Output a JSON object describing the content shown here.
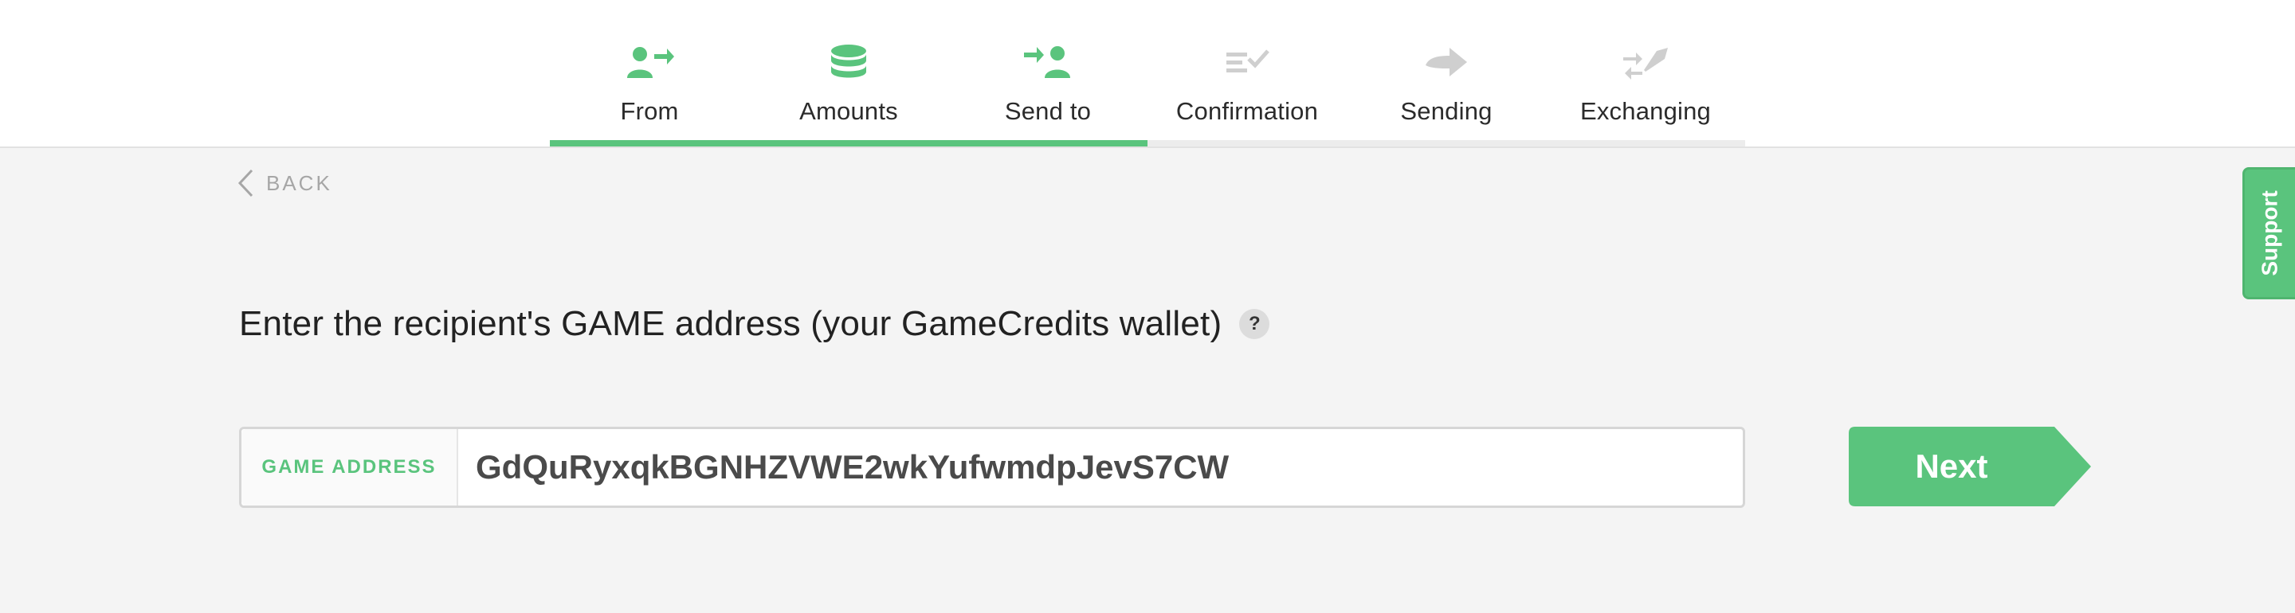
{
  "steps": [
    {
      "label": "From",
      "icon": "user-arrow-icon",
      "active": true
    },
    {
      "label": "Amounts",
      "icon": "coins-stack-icon",
      "active": true
    },
    {
      "label": "Send to",
      "icon": "send-to-user-icon",
      "active": true
    },
    {
      "label": "Confirmation",
      "icon": "checklist-icon",
      "active": false
    },
    {
      "label": "Sending",
      "icon": "arrow-right-icon",
      "active": false
    },
    {
      "label": "Exchanging",
      "icon": "rocket-exchange-icon",
      "active": false
    }
  ],
  "progress_fraction": 0.5,
  "back_label": "BACK",
  "support_label": "Support",
  "prompt": {
    "text": "Enter the recipient's GAME address (your GameCredits wallet)",
    "help": "?"
  },
  "address": {
    "label": "GAME ADDRESS",
    "value": "GdQuRyxqkBGNHZVWE2wkYufwmdpJevS7CW"
  },
  "next_label": "Next",
  "colors": {
    "accent": "#5ac47d",
    "inactive_icon": "#cfcfcf",
    "background": "#f4f4f4"
  }
}
